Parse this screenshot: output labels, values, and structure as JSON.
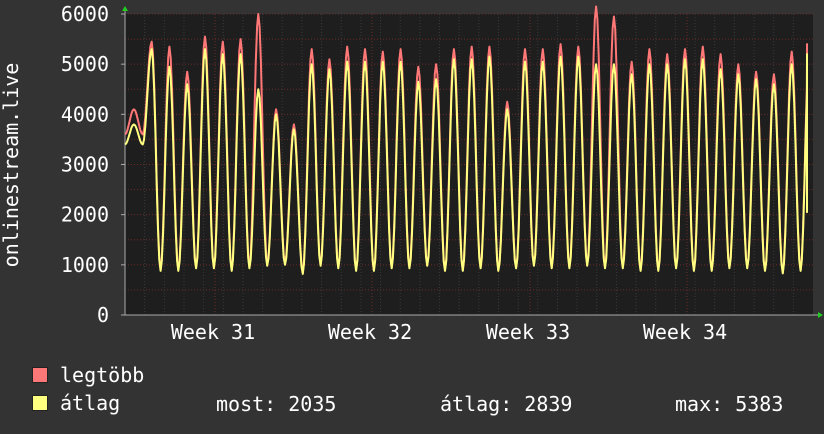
{
  "chart_data": {
    "type": "line",
    "ylabel": "onlinestream.live",
    "yticks": [
      0,
      1000,
      2000,
      3000,
      4000,
      5000,
      6000
    ],
    "ylim": [
      0,
      6000
    ],
    "xticks": [
      "Week 31",
      "Week 32",
      "Week 33",
      "Week 34"
    ],
    "grid": true,
    "background": "#1e1e1e",
    "grid_color": "#6b2a2a",
    "period_days": 35,
    "series": [
      {
        "name": "legtöbb",
        "color": "#ff7777",
        "peaks": [
          4100,
          5450,
          5350,
          4850,
          5550,
          5450,
          5500,
          6000,
          4100,
          3800,
          5300,
          5100,
          5350,
          5300,
          5250,
          5300,
          4950,
          5000,
          5300,
          5350,
          5350,
          4250,
          5300,
          5300,
          5400,
          5350,
          6150,
          5950,
          5050,
          5300,
          5200,
          5300,
          5350,
          5200,
          5000,
          4850,
          4800,
          5250,
          5400
        ],
        "troughs": [
          3600,
          900,
          900,
          950,
          950,
          900,
          950,
          1000,
          1050,
          850,
          1000,
          950,
          900,
          900,
          950,
          950,
          1000,
          900,
          900,
          950,
          900,
          950,
          1000,
          950,
          950,
          1000,
          950,
          950,
          900,
          900,
          950,
          900,
          900,
          950,
          950,
          900,
          850,
          900,
          2100
        ]
      },
      {
        "name": "átlag",
        "color": "#ffff80",
        "peaks": [
          3800,
          5300,
          4950,
          4600,
          5300,
          5200,
          5200,
          4500,
          4000,
          3700,
          5000,
          4900,
          5050,
          5050,
          5050,
          5050,
          4650,
          4700,
          5100,
          5100,
          5150,
          4100,
          5050,
          5050,
          5150,
          5150,
          5000,
          5000,
          4800,
          5000,
          5000,
          5100,
          5100,
          4900,
          4800,
          4700,
          4600,
          5000,
          5200
        ],
        "troughs": [
          3400,
          880,
          880,
          930,
          930,
          880,
          930,
          980,
          1000,
          820,
          980,
          930,
          880,
          880,
          930,
          930,
          980,
          880,
          880,
          930,
          880,
          930,
          980,
          930,
          930,
          980,
          930,
          930,
          880,
          880,
          930,
          880,
          880,
          930,
          930,
          880,
          830,
          880,
          2035
        ]
      }
    ]
  },
  "legend": {
    "max_label": "legtöbb",
    "max_color": "#ff7777",
    "avg_label": "átlag",
    "avg_color": "#ffff80"
  },
  "stats": {
    "now": "most: 2035",
    "avg": "átlag: 2839",
    "max": "max: 5383"
  }
}
